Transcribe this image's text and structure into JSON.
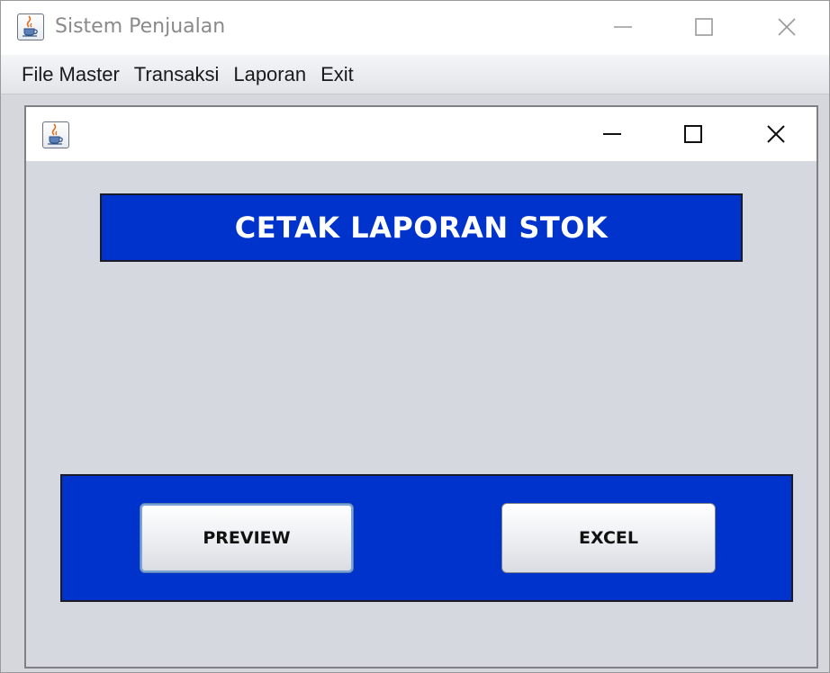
{
  "window": {
    "title": "Sistem Penjualan",
    "app_icon": "java-cup-icon",
    "controls": [
      "minimize-icon",
      "maximize-icon",
      "close-icon"
    ]
  },
  "menu": {
    "items": [
      {
        "label": "File Master"
      },
      {
        "label": "Transaksi"
      },
      {
        "label": "Laporan"
      },
      {
        "label": "Exit"
      }
    ]
  },
  "internal_frame": {
    "title": "",
    "app_icon": "java-cup-icon",
    "heading": "CETAK LAPORAN STOK",
    "buttons": {
      "preview_label": "PREVIEW",
      "excel_label": "EXCEL"
    }
  },
  "colors": {
    "panel_blue": "#0033cc",
    "frame_background": "#d5d8df",
    "heading_text": "#ffffff"
  }
}
